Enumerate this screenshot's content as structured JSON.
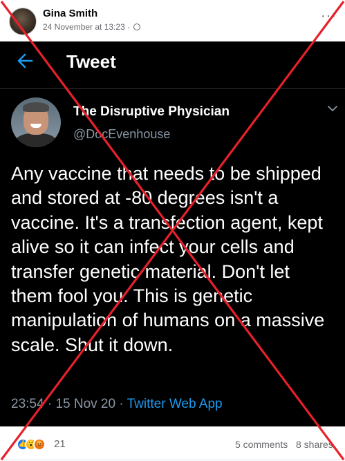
{
  "post": {
    "poster_name": "Gina Smith",
    "timestamp": "24 November at 13:23",
    "separator": " · ",
    "audience_icon": "globe-icon",
    "more_icon": "more-options-icon",
    "more_label": "···"
  },
  "tweet": {
    "screen_title": "Tweet",
    "back_icon": "back-arrow-icon",
    "display_name": "The Disruptive Physician",
    "handle": "@DocEvenhouse",
    "text": "Any vaccine that needs to be shipped and stored at -80 degrees isn't a vaccine. It's a transfection agent, kept alive so it can infect your cells and transfer genetic material. Don't let them fool you. This is genetic manipulation of humans on a massive scale. Shut it down.",
    "time": "23:54",
    "date": "15 Nov 20",
    "dot": " · ",
    "source_app": "Twitter Web App",
    "accent_color": "#1d9bf0"
  },
  "footer": {
    "reaction_icons": [
      "like-icon",
      "wow-icon",
      "angry-icon"
    ],
    "reaction_count": "21",
    "comments": "5 comments",
    "shares": "8 shares"
  },
  "overlay": {
    "cross_color": "#e8202a"
  }
}
